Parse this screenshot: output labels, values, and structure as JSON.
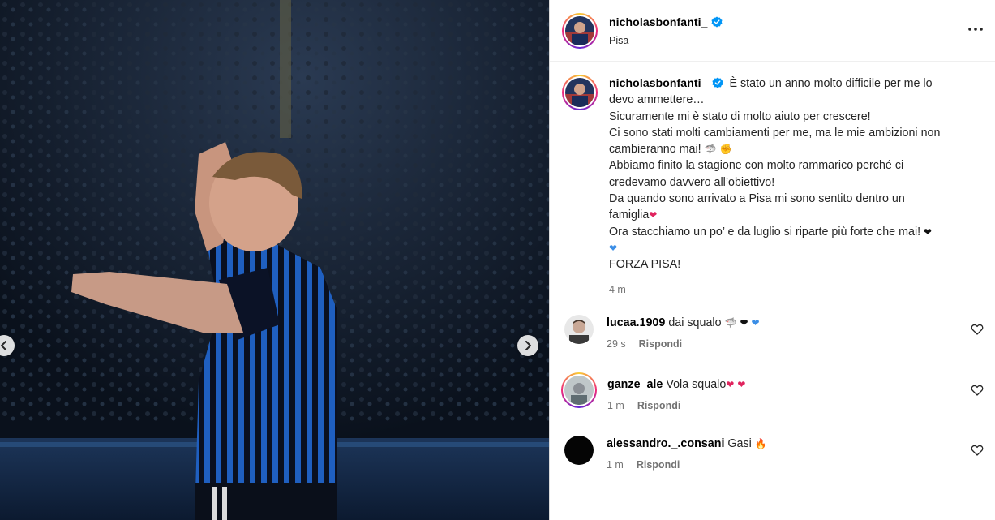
{
  "post": {
    "author": "nicholasbonfanti_",
    "location": "Pisa",
    "verified": true,
    "caption": {
      "first": "È stato un anno molto difficile per me lo",
      "lines": [
        "devo ammettere…",
        "Sicuramente mi è stato di molto aiuto per crescere!",
        "Ci sono stati molti cambiamenti per me, ma le mie ambizioni non",
        "cambieranno mai! ",
        "Abbiamo finito la stagione con molto rammarico perché ci",
        "credevamo davvero all’obiettivo!",
        "Da quando sono arrivato a Pisa mi sono sentito dentro un",
        "famiglia",
        "Ora stacchiamo un po’ e da luglio si riparte più forte che mai!",
        "",
        "FORZA PISA!"
      ],
      "time": "4 m"
    }
  },
  "comments": [
    {
      "user": "lucaa.1909",
      "text": "dai squalo ",
      "time": "29 s",
      "reply": "Rispondi"
    },
    {
      "user": "ganze_ale",
      "text": "Vola squalo",
      "time": "1 m",
      "reply": "Rispondi"
    },
    {
      "user": "alessandro._.consani",
      "text": "Gasi ",
      "time": "1 m",
      "reply": "Rispondi"
    }
  ],
  "icons": {
    "more": "more-options-icon",
    "verified": "verified-badge-icon",
    "prev": "chevron-left-icon",
    "next": "chevron-right-icon",
    "like": "heart-outline-icon"
  },
  "colors": {
    "verified": "#0095f6",
    "secondary_text": "#737373",
    "heart_red": "#e0245e",
    "heart_blue": "#3b8ee6"
  }
}
